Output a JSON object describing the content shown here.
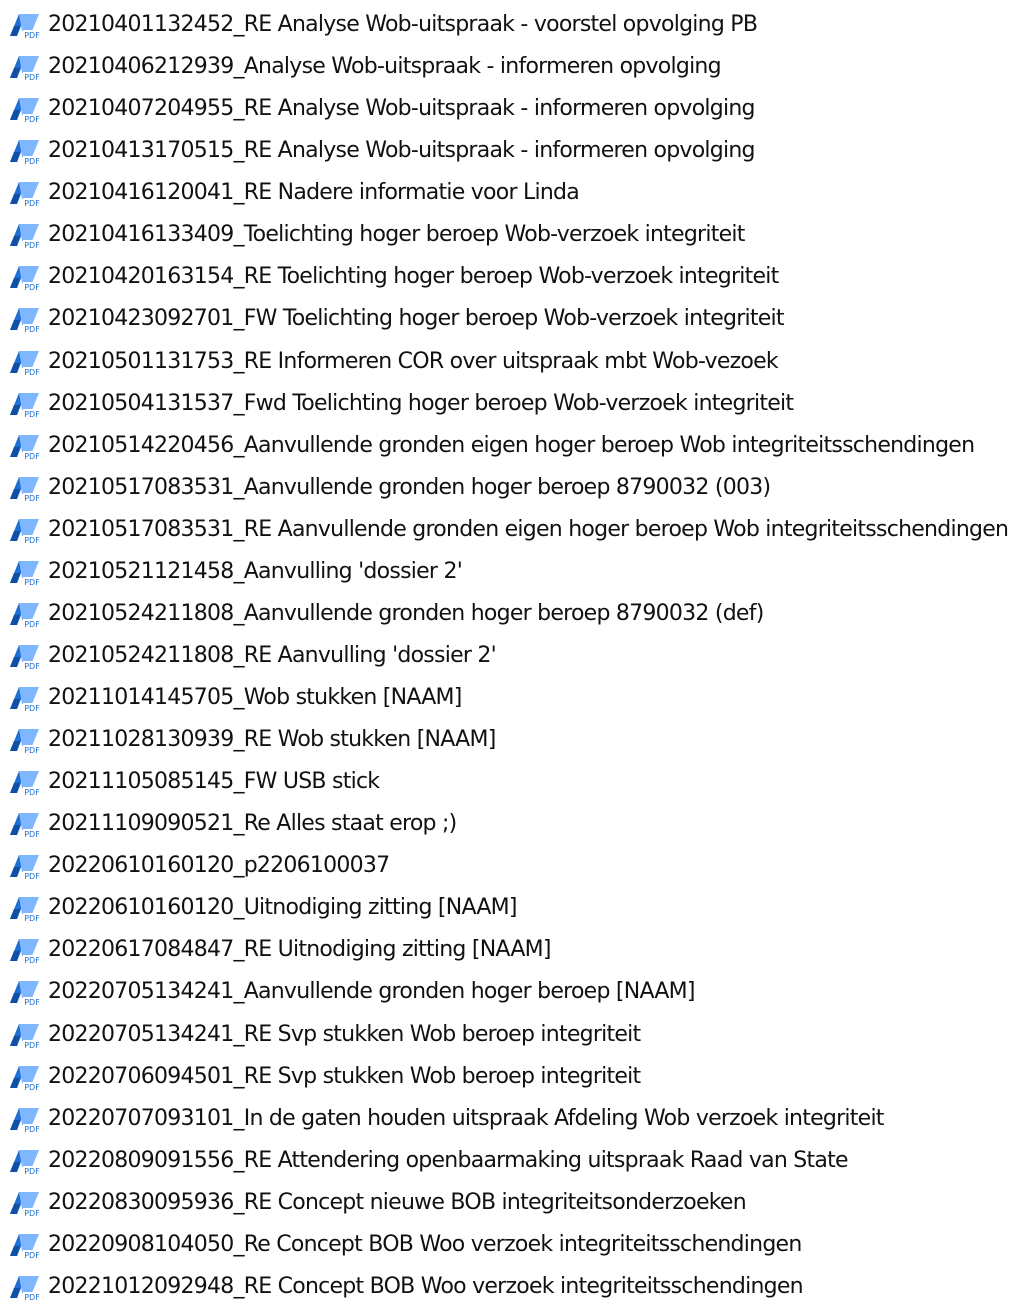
{
  "icon": {
    "name": "pdf-file-icon",
    "text": "PDF",
    "color_primary": "#1f6fd3",
    "color_secondary": "#7fb7ff"
  },
  "files": [
    {
      "name": "20210401132452_RE Analyse Wob-uitspraak - voorstel opvolging  PB"
    },
    {
      "name": "20210406212939_Analyse Wob-uitspraak - informeren opvolging"
    },
    {
      "name": "20210407204955_RE Analyse Wob-uitspraak - informeren opvolging"
    },
    {
      "name": "20210413170515_RE Analyse Wob-uitspraak - informeren opvolging"
    },
    {
      "name": "20210416120041_RE Nadere informatie voor Linda"
    },
    {
      "name": "20210416133409_Toelichting hoger beroep Wob-verzoek integriteit"
    },
    {
      "name": "20210420163154_RE Toelichting hoger beroep Wob-verzoek integriteit"
    },
    {
      "name": "20210423092701_FW Toelichting hoger beroep Wob-verzoek integriteit"
    },
    {
      "name": "20210501131753_RE Informeren COR over uitspraak mbt Wob-vezoek"
    },
    {
      "name": "20210504131537_Fwd Toelichting hoger beroep Wob-verzoek integriteit"
    },
    {
      "name": "20210514220456_Aanvullende gronden eigen hoger beroep Wob integriteitsschendingen"
    },
    {
      "name": "20210517083531_Aanvullende gronden hoger beroep 8790032 (003)"
    },
    {
      "name": "20210517083531_RE Aanvullende gronden eigen hoger beroep Wob integriteitsschendingen"
    },
    {
      "name": "20210521121458_Aanvulling 'dossier 2'"
    },
    {
      "name": "20210524211808_Aanvullende gronden hoger beroep 8790032 (def)"
    },
    {
      "name": "20210524211808_RE Aanvulling 'dossier 2'"
    },
    {
      "name": "20211014145705_Wob stukken [NAAM]"
    },
    {
      "name": "20211028130939_RE Wob stukken [NAAM]"
    },
    {
      "name": "20211105085145_FW USB stick"
    },
    {
      "name": "20211109090521_Re Alles staat erop ;)"
    },
    {
      "name": "20220610160120_p2206100037"
    },
    {
      "name": "20220610160120_Uitnodiging zitting [NAAM]"
    },
    {
      "name": "20220617084847_RE Uitnodiging zitting [NAAM]"
    },
    {
      "name": "20220705134241_Aanvullende gronden hoger beroep [NAAM]"
    },
    {
      "name": "20220705134241_RE Svp stukken Wob beroep integriteit"
    },
    {
      "name": "20220706094501_RE Svp stukken Wob beroep integriteit"
    },
    {
      "name": "20220707093101_In de gaten houden uitspraak Afdeling Wob verzoek integriteit"
    },
    {
      "name": "20220809091556_RE Attendering openbaarmaking uitspraak Raad van State"
    },
    {
      "name": "20220830095936_RE Concept nieuwe BOB integriteitsonderzoeken"
    },
    {
      "name": "20220908104050_Re Concept BOB Woo verzoek integriteitsschendingen"
    },
    {
      "name": "20221012092948_RE Concept BOB Woo verzoek integriteitsschendingen"
    }
  ]
}
